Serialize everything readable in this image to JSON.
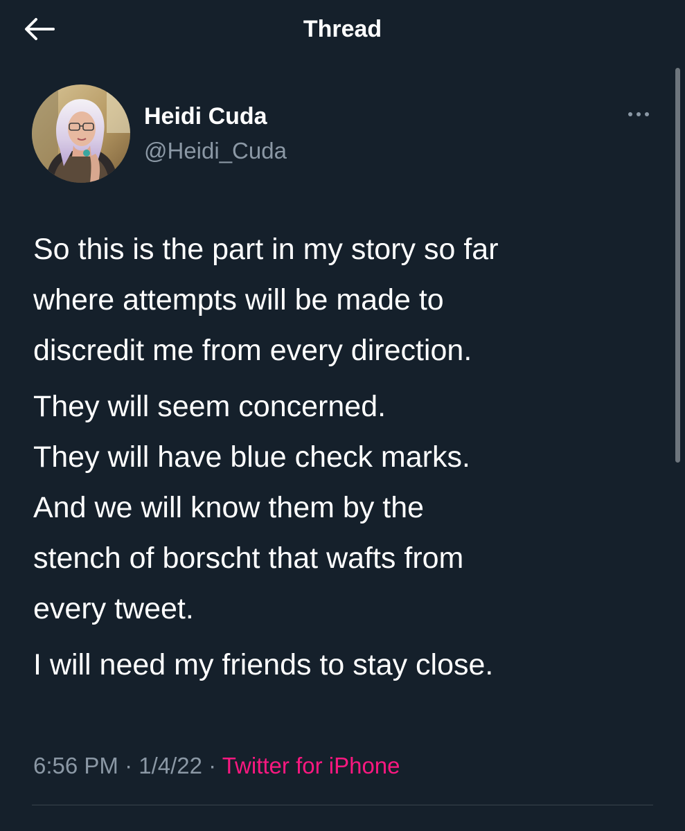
{
  "header": {
    "title": "Thread",
    "back_icon": "arrow-left-icon"
  },
  "author": {
    "display_name": "Heidi Cuda",
    "handle": "@Heidi_Cuda",
    "more_icon": "more-horizontal-icon"
  },
  "tweet": {
    "paragraphs": [
      "So this is the part in my story so far\nwhere attempts will be made to\ndiscredit me from every direction.",
      "They will seem concerned.\nThey will have blue check marks.\nAnd we will know them by the\nstench of borscht that wafts from\nevery tweet.",
      "I will need my friends to stay close."
    ],
    "time": "6:56 PM",
    "separator": " · ",
    "date": "1/4/22",
    "source": "Twitter for iPhone"
  },
  "colors": {
    "background": "#15202b",
    "text": "#ffffff",
    "secondary_text": "#8b98a5",
    "source_link": "#f91880",
    "divider": "#38444d"
  }
}
